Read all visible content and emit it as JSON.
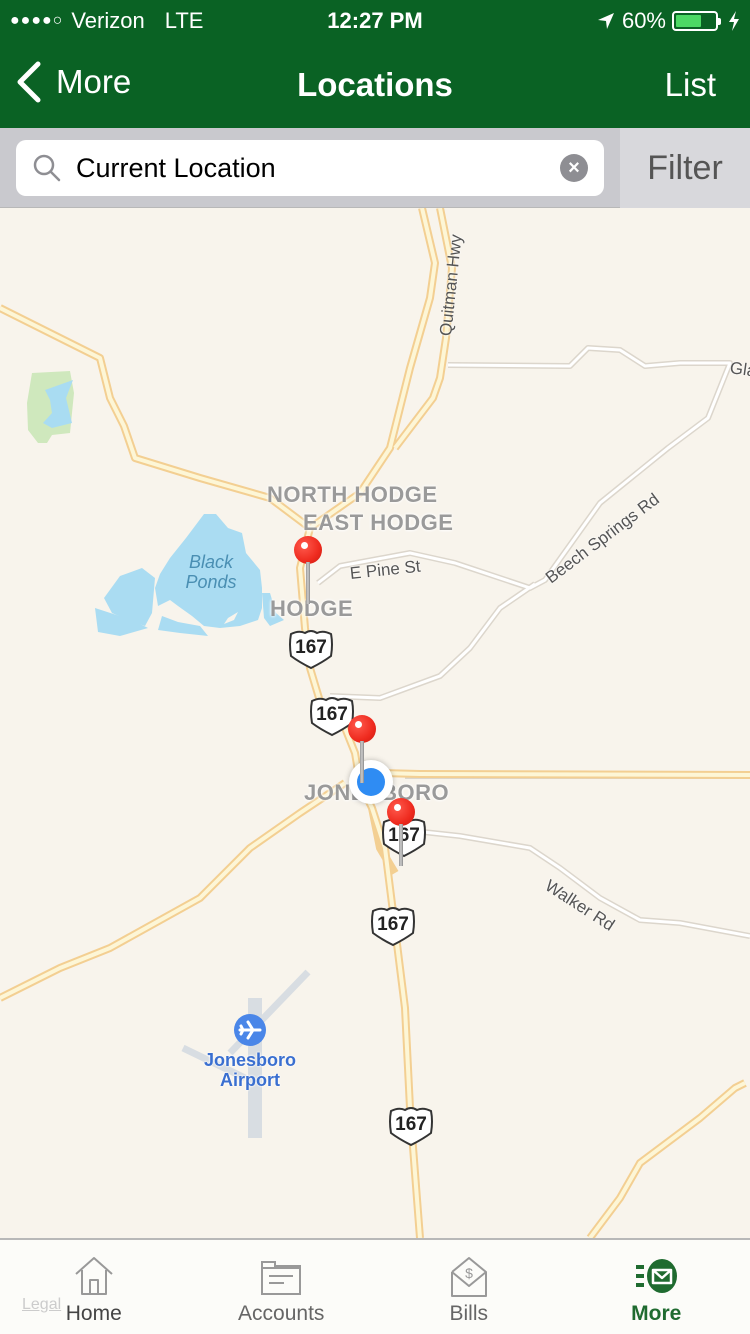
{
  "status_bar": {
    "carrier": "Verizon",
    "network": "LTE",
    "signal_dots": "●●●●○",
    "time": "12:27 PM",
    "battery_percent": "60%",
    "battery_level": 0.6
  },
  "nav": {
    "back_label": "More",
    "title": "Locations",
    "right_label": "List"
  },
  "search": {
    "value": "Current Location",
    "placeholder": "Search",
    "filter_label": "Filter"
  },
  "map": {
    "place_labels": {
      "north_hodge": "North Hodge",
      "east_hodge": "East Hodge",
      "hodge": "Hodge",
      "jonesboro": "Jonesboro"
    },
    "road_labels": {
      "quitman_hwy": "Quitman Hwy",
      "beech_springs": "Beech Springs Rd",
      "e_pine": "E Pine St",
      "walker": "Walker Rd",
      "gla": "Gla"
    },
    "water_label": "Black Ponds",
    "airport_label": "Jonesboro Airport",
    "highway_number": "167",
    "legal": "Legal",
    "pins": [
      {
        "name": "location-pin-hodge"
      },
      {
        "name": "location-pin-jonesboro-north"
      },
      {
        "name": "location-pin-jonesboro-south"
      }
    ]
  },
  "tabs": [
    {
      "label": "Home",
      "icon": "house-icon"
    },
    {
      "label": "Accounts",
      "icon": "folder-icon"
    },
    {
      "label": "Bills",
      "icon": "bill-envelope-icon"
    },
    {
      "label": "More",
      "icon": "more-mail-icon",
      "active": true
    }
  ],
  "colors": {
    "brand_green": "#0a6224",
    "active_tab": "#1f6b30",
    "pin_red": "#ee2a1e",
    "user_blue": "#2f8cf3"
  }
}
